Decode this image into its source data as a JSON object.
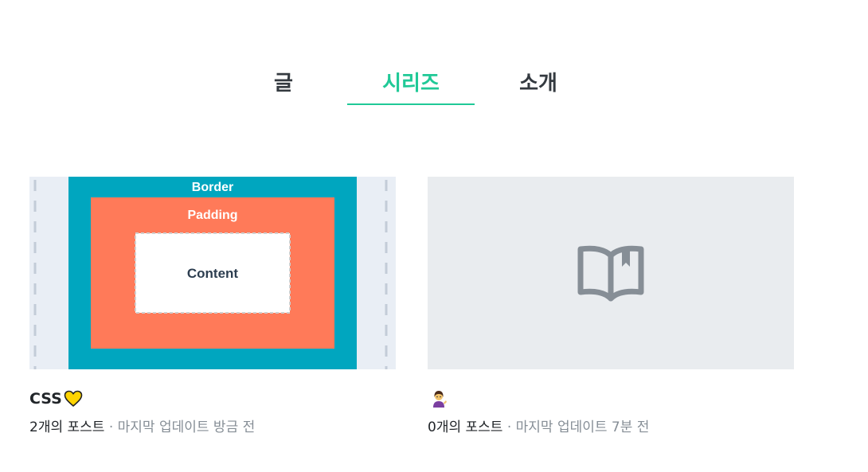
{
  "tabs": [
    {
      "label": "글"
    },
    {
      "label": "시리즈"
    },
    {
      "label": "소개"
    }
  ],
  "active_tab": "시리즈",
  "accent_color": "#20c997",
  "series": [
    {
      "thumbnail": {
        "type": "css-box-model",
        "border_label": "Border",
        "padding_label": "Padding",
        "content_label": "Content",
        "border_color": "#00a6bf",
        "padding_color": "#ff7a59"
      },
      "title": "CSS",
      "title_emoji": "yellow-heart-icon",
      "count_text": "2개의 포스트",
      "separator": " · ",
      "updated_text": "마지막 업데이트 방금 전"
    },
    {
      "thumbnail": {
        "type": "placeholder",
        "icon": "open-book-icon"
      },
      "title": "",
      "title_emoji": "woman-tipping-hand-icon",
      "count_text": "0개의 포스트",
      "separator": " · ",
      "updated_text": "마지막 업데이트 7분 전"
    }
  ]
}
